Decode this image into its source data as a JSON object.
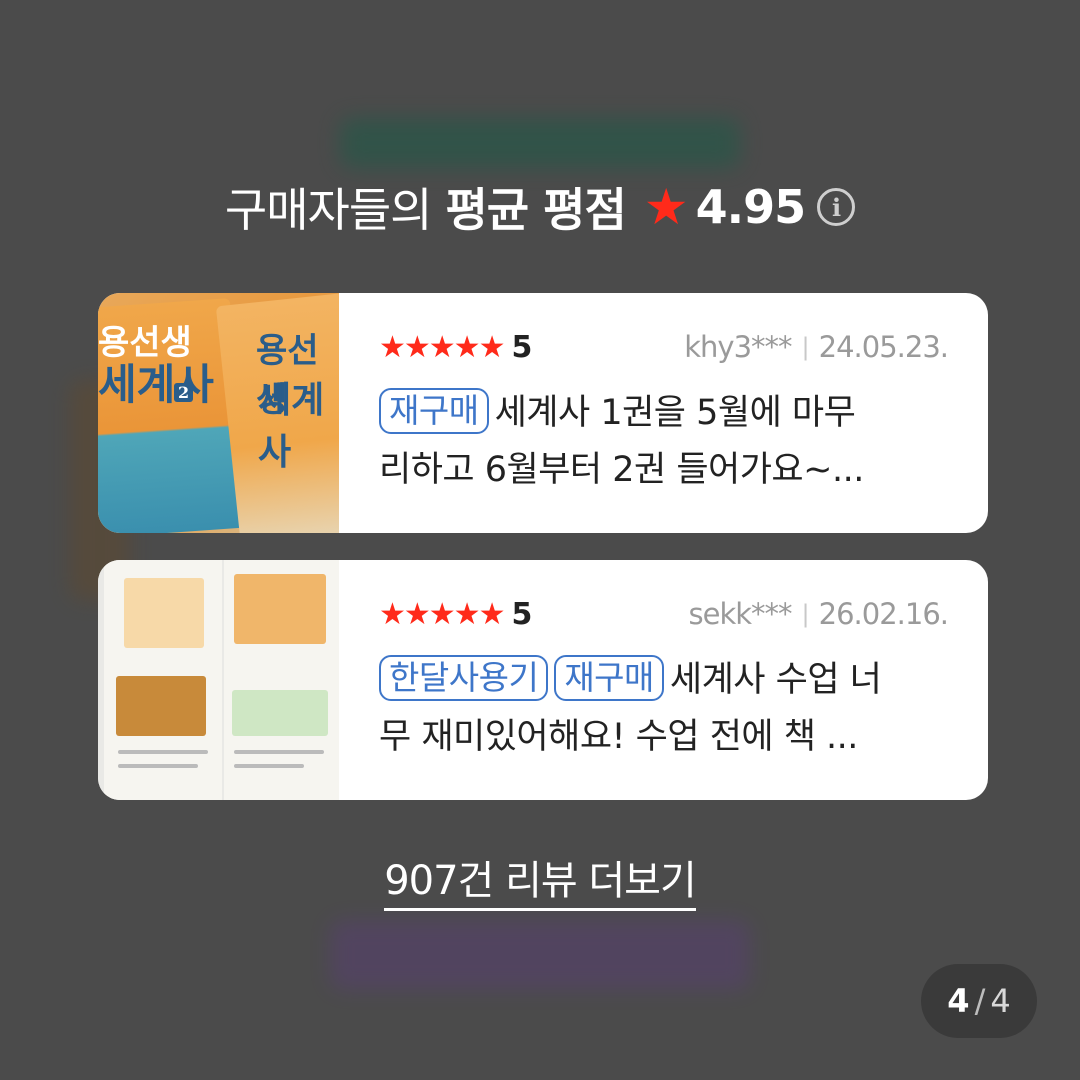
{
  "header": {
    "prefix": "구매자들의",
    "emphasis": "평균 평점",
    "star": "★",
    "score": "4.95",
    "info_glyph": "i"
  },
  "reviews": [
    {
      "stars": "★★★★★",
      "rating": "5",
      "user": "khy3***",
      "date": "24.05.23.",
      "tags": [
        "재구매"
      ],
      "text_line1": "세계사 1권을 5월에 마무",
      "text_line2": "리하고 6월부터 2권 들어가요~...",
      "thumb_text_a": "용선생",
      "thumb_text_b": "세계사",
      "thumb_text_c": "세계사",
      "thumb_text_d": "2"
    },
    {
      "stars": "★★★★★",
      "rating": "5",
      "user": "sekk***",
      "date": "26.02.16.",
      "tags": [
        "한달사용기",
        "재구매"
      ],
      "text_line1": "세계사 수업 너",
      "text_line2": "무 재미있어해요! 수업 전에 책 ..."
    }
  ],
  "more_link": "907건 리뷰 더보기",
  "pager": {
    "current": "4",
    "separator": "/",
    "total": "4"
  },
  "colors": {
    "star": "#ff2a1a",
    "tag": "#3e76c9",
    "background": "#4b4b4b"
  }
}
